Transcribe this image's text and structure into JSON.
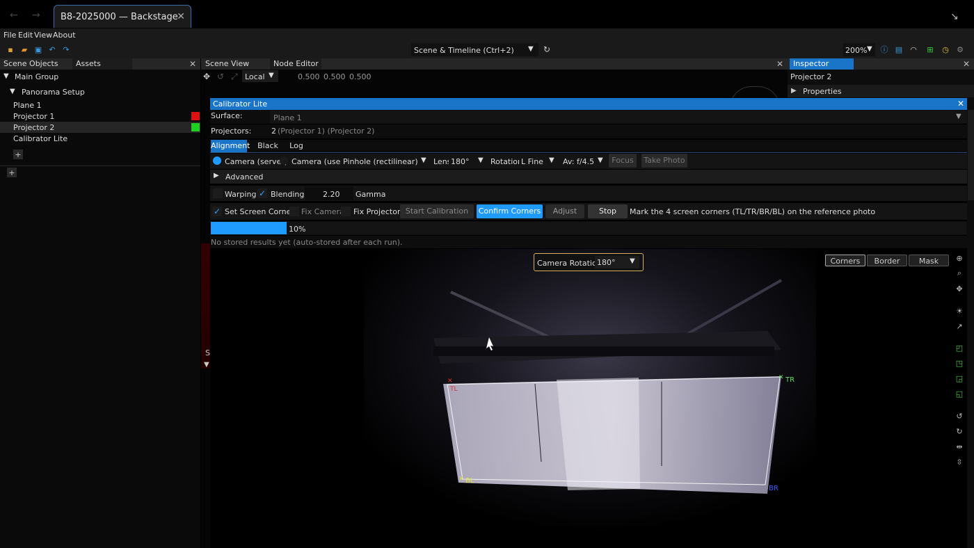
{
  "window": {
    "tab_title": "B8-2025000 — Backstage"
  },
  "menu": [
    "File",
    "Edit",
    "View",
    "About"
  ],
  "toolbar": {
    "layout_selector": "Scene & Timeline  (Ctrl+2)",
    "zoom": "200%"
  },
  "left_panel": {
    "tabs": [
      "Scene Objects",
      "Assets"
    ],
    "tree": {
      "root": "Main Group",
      "group": "Panorama Setup",
      "items": [
        {
          "label": "Plane 1",
          "color": ""
        },
        {
          "label": "Projector 1",
          "color": "#e01010"
        },
        {
          "label": "Projector 2",
          "color": "#20d020"
        },
        {
          "label": "Calibrator Lite",
          "color": ""
        }
      ],
      "add": "+"
    }
  },
  "scene_view": {
    "tabs": [
      "Scene View",
      "Node Editor"
    ],
    "space": "Local",
    "values": [
      "0.500",
      "0.500",
      "0.500"
    ],
    "partial_label": "Se"
  },
  "inspector": {
    "tab": "Inspector",
    "object": "Projector 2",
    "section": "Properties"
  },
  "calibrator": {
    "title": "Calibrator Lite",
    "surface_label": "Surface:",
    "surface_value": "Plane 1",
    "projectors_label": "Projectors:",
    "projectors_count": "2",
    "projectors_names": "(Projector 1) (Projector 2)",
    "tabs": [
      "Alignment",
      "Black Level",
      "Log"
    ],
    "camera_server": "Camera (server)",
    "camera_user": "Camera (user)",
    "lens_model": "Pinhole (rectilinear)",
    "lens_label": "Lens",
    "lens_value": "180°",
    "rotation_label": "Rotation",
    "rotation_value": "L Fine",
    "aperture": "Av: f/4.5",
    "focus": "Focus",
    "take_photo": "Take Photo",
    "advanced": "Advanced",
    "warping": "Warping",
    "blending": "Blending",
    "gamma_value": "2.20",
    "gamma_label": "Gamma",
    "set_screen_corners": "Set Screen Corners",
    "fix_camera": "Fix Camera",
    "fix_projectors": "Fix Projectors",
    "start_calibration": "Start Calibration",
    "confirm_corners": "Confirm Corners",
    "adjust": "Adjust",
    "stop": "Stop",
    "instruction": "Mark the 4 screen corners (TL/TR/BR/BL) on the reference photo",
    "progress": 0.1,
    "progress_label": "10%",
    "results_note": "No stored results yet (auto-stored after each run).",
    "camera_rotation_label": "Camera Rotation:",
    "camera_rotation_value": "180°",
    "view_modes": [
      "Corners",
      "Border",
      "Mask"
    ],
    "corners": {
      "tl": "TL",
      "tr": "TR",
      "bl": "BL",
      "br": "BR"
    }
  },
  "colors": {
    "accent": "#1a74c8",
    "confirm": "#1f9bff",
    "tl": "#e03030",
    "tr": "#60e060",
    "bl": "#e0e040",
    "br": "#4060ff"
  }
}
